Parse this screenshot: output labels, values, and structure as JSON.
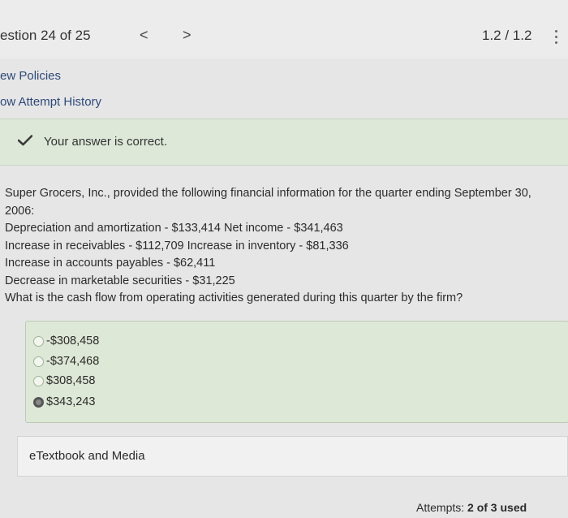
{
  "header": {
    "question_counter": "estion 24 of 25",
    "prev_symbol": "<",
    "next_symbol": ">",
    "score": "1.2 / 1.2"
  },
  "links": {
    "policies": "ew Policies",
    "attempt_history": "ow Attempt History"
  },
  "feedback": {
    "message": "Your answer is correct."
  },
  "question": {
    "lines": [
      "Super Grocers, Inc., provided the following financial information for the quarter ending September 30,",
      "2006:",
      "Depreciation and amortization - $133,414 Net income - $341,463",
      "Increase in receivables - $112,709 Increase in inventory - $81,336",
      "Increase in accounts payables - $62,411",
      "Decrease in marketable securities - $31,225",
      "What is the cash flow from operating activities generated during this quarter by the firm?"
    ]
  },
  "options": [
    {
      "label": "-$308,458",
      "selected": false
    },
    {
      "label": "-$374,468",
      "selected": false
    },
    {
      "label": "$308,458",
      "selected": false
    },
    {
      "label": "$343,243",
      "selected": true
    }
  ],
  "resources": {
    "etextbook_label": "eTextbook and Media"
  },
  "footer": {
    "attempts_label": "Attempts:",
    "attempts_value": "2 of 3 used"
  },
  "colors": {
    "banner_bg": "#dde8d8",
    "answer_box_bg": "#dde8d6",
    "link": "#2d4a7a"
  }
}
